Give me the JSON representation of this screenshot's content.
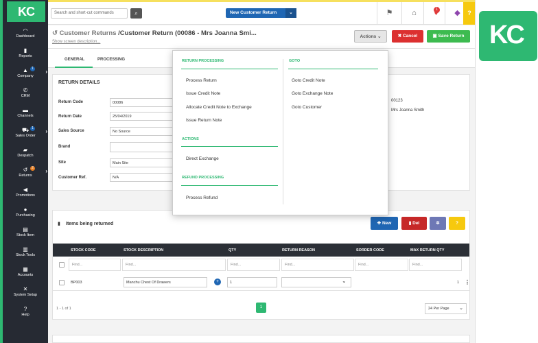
{
  "brand": {
    "logo": "KC",
    "accent": "#2eb872"
  },
  "sidebar": [
    {
      "label": "Dashboard",
      "icon": "dashboard-icon"
    },
    {
      "label": "Reports",
      "icon": "reports-icon"
    },
    {
      "label": "Company",
      "icon": "company-icon",
      "badge": "1"
    },
    {
      "label": "CRM",
      "icon": "phone-icon"
    },
    {
      "label": "Channels",
      "icon": "channels-icon"
    },
    {
      "label": "Sales Order",
      "icon": "cart-icon",
      "badge": "1"
    },
    {
      "label": "Despatch",
      "icon": "truck-icon"
    },
    {
      "label": "Returns",
      "icon": "returns-icon",
      "badge": "2"
    },
    {
      "label": "Promotions",
      "icon": "megaphone-icon"
    },
    {
      "label": "Purchasing",
      "icon": "purchasing-icon"
    },
    {
      "label": "Stock Item",
      "icon": "stock-item-icon"
    },
    {
      "label": "Stock Tools",
      "icon": "stock-tools-icon"
    },
    {
      "label": "Accounts",
      "icon": "accounts-icon"
    },
    {
      "label": "System Setup",
      "icon": "setup-icon"
    },
    {
      "label": "Help",
      "icon": "help-icon"
    }
  ],
  "topbar": {
    "search_placeholder": "Search and short-cut commands",
    "new_button": "New Customer Return",
    "notif_count": "1",
    "help": "?"
  },
  "header": {
    "prefix": "Customer Returns",
    "title": "/Customer Return (00086 - Mrs Joanna Smi...",
    "show_desc": "Show screen description...",
    "actions": "Actions",
    "cancel": "Cancel",
    "save": "Save Return"
  },
  "tabs": [
    "GENERAL",
    "PROCESSING"
  ],
  "details": {
    "title": "RETURN DETAILS",
    "fields": [
      {
        "label": "Return Code",
        "value": "00086"
      },
      {
        "label": "Return Date",
        "value": "25/04/2019"
      },
      {
        "label": "Sales Source",
        "value": "No Source"
      },
      {
        "label": "Brand",
        "value": ""
      },
      {
        "label": "Site",
        "value": "Main Site"
      },
      {
        "label": "Customer Ref.",
        "value": "N/A"
      }
    ],
    "right_values": [
      "00123",
      "Mrs Joanna Smith"
    ]
  },
  "items": {
    "title": "Items being returned",
    "new": "New",
    "del": "Del",
    "columns": [
      "STOCK CODE",
      "STOCK DESCRIPTION",
      "QTY",
      "RETURN REASON",
      "SORDER CODE",
      "MAX RETURN QTY"
    ],
    "find": "Find...",
    "rows": [
      {
        "code": "BP003",
        "description": "Manchu Chest Of Drawers",
        "qty": "1",
        "reason": "",
        "sorder": "",
        "max": "1"
      }
    ],
    "pager": "1 - 1 of 1",
    "page": "1",
    "per_page": "24 Per Page"
  },
  "popup": {
    "return_processing": {
      "title": "RETURN PROCESSING",
      "items": [
        "Process Return",
        "Issue Credit Note",
        "Allocate Credit Note to Exchange",
        "Issue Return Note"
      ]
    },
    "actions": {
      "title": "ACTIONS",
      "items": [
        "Direct Exchange"
      ]
    },
    "refund": {
      "title": "REFUND PROCESSING",
      "items": [
        "Process Refund"
      ]
    },
    "goto": {
      "title": "GOTO",
      "items": [
        "Goto Credit Note",
        "Goto Exchange Note",
        "Goto Customer"
      ]
    }
  },
  "bigbrand": "KC"
}
